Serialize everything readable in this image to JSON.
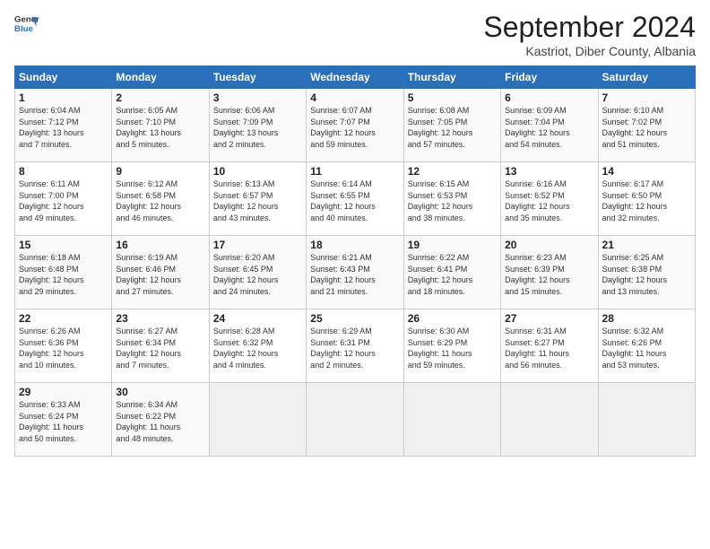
{
  "header": {
    "logo_line1": "General",
    "logo_line2": "Blue",
    "month": "September 2024",
    "location": "Kastriot, Diber County, Albania"
  },
  "weekdays": [
    "Sunday",
    "Monday",
    "Tuesday",
    "Wednesday",
    "Thursday",
    "Friday",
    "Saturday"
  ],
  "weeks": [
    [
      {
        "day": "1",
        "info": "Sunrise: 6:04 AM\nSunset: 7:12 PM\nDaylight: 13 hours\nand 7 minutes."
      },
      {
        "day": "2",
        "info": "Sunrise: 6:05 AM\nSunset: 7:10 PM\nDaylight: 13 hours\nand 5 minutes."
      },
      {
        "day": "3",
        "info": "Sunrise: 6:06 AM\nSunset: 7:09 PM\nDaylight: 13 hours\nand 2 minutes."
      },
      {
        "day": "4",
        "info": "Sunrise: 6:07 AM\nSunset: 7:07 PM\nDaylight: 12 hours\nand 59 minutes."
      },
      {
        "day": "5",
        "info": "Sunrise: 6:08 AM\nSunset: 7:05 PM\nDaylight: 12 hours\nand 57 minutes."
      },
      {
        "day": "6",
        "info": "Sunrise: 6:09 AM\nSunset: 7:04 PM\nDaylight: 12 hours\nand 54 minutes."
      },
      {
        "day": "7",
        "info": "Sunrise: 6:10 AM\nSunset: 7:02 PM\nDaylight: 12 hours\nand 51 minutes."
      }
    ],
    [
      {
        "day": "8",
        "info": "Sunrise: 6:11 AM\nSunset: 7:00 PM\nDaylight: 12 hours\nand 49 minutes."
      },
      {
        "day": "9",
        "info": "Sunrise: 6:12 AM\nSunset: 6:58 PM\nDaylight: 12 hours\nand 46 minutes."
      },
      {
        "day": "10",
        "info": "Sunrise: 6:13 AM\nSunset: 6:57 PM\nDaylight: 12 hours\nand 43 minutes."
      },
      {
        "day": "11",
        "info": "Sunrise: 6:14 AM\nSunset: 6:55 PM\nDaylight: 12 hours\nand 40 minutes."
      },
      {
        "day": "12",
        "info": "Sunrise: 6:15 AM\nSunset: 6:53 PM\nDaylight: 12 hours\nand 38 minutes."
      },
      {
        "day": "13",
        "info": "Sunrise: 6:16 AM\nSunset: 6:52 PM\nDaylight: 12 hours\nand 35 minutes."
      },
      {
        "day": "14",
        "info": "Sunrise: 6:17 AM\nSunset: 6:50 PM\nDaylight: 12 hours\nand 32 minutes."
      }
    ],
    [
      {
        "day": "15",
        "info": "Sunrise: 6:18 AM\nSunset: 6:48 PM\nDaylight: 12 hours\nand 29 minutes."
      },
      {
        "day": "16",
        "info": "Sunrise: 6:19 AM\nSunset: 6:46 PM\nDaylight: 12 hours\nand 27 minutes."
      },
      {
        "day": "17",
        "info": "Sunrise: 6:20 AM\nSunset: 6:45 PM\nDaylight: 12 hours\nand 24 minutes."
      },
      {
        "day": "18",
        "info": "Sunrise: 6:21 AM\nSunset: 6:43 PM\nDaylight: 12 hours\nand 21 minutes."
      },
      {
        "day": "19",
        "info": "Sunrise: 6:22 AM\nSunset: 6:41 PM\nDaylight: 12 hours\nand 18 minutes."
      },
      {
        "day": "20",
        "info": "Sunrise: 6:23 AM\nSunset: 6:39 PM\nDaylight: 12 hours\nand 15 minutes."
      },
      {
        "day": "21",
        "info": "Sunrise: 6:25 AM\nSunset: 6:38 PM\nDaylight: 12 hours\nand 13 minutes."
      }
    ],
    [
      {
        "day": "22",
        "info": "Sunrise: 6:26 AM\nSunset: 6:36 PM\nDaylight: 12 hours\nand 10 minutes."
      },
      {
        "day": "23",
        "info": "Sunrise: 6:27 AM\nSunset: 6:34 PM\nDaylight: 12 hours\nand 7 minutes."
      },
      {
        "day": "24",
        "info": "Sunrise: 6:28 AM\nSunset: 6:32 PM\nDaylight: 12 hours\nand 4 minutes."
      },
      {
        "day": "25",
        "info": "Sunrise: 6:29 AM\nSunset: 6:31 PM\nDaylight: 12 hours\nand 2 minutes."
      },
      {
        "day": "26",
        "info": "Sunrise: 6:30 AM\nSunset: 6:29 PM\nDaylight: 11 hours\nand 59 minutes."
      },
      {
        "day": "27",
        "info": "Sunrise: 6:31 AM\nSunset: 6:27 PM\nDaylight: 11 hours\nand 56 minutes."
      },
      {
        "day": "28",
        "info": "Sunrise: 6:32 AM\nSunset: 6:26 PM\nDaylight: 11 hours\nand 53 minutes."
      }
    ],
    [
      {
        "day": "29",
        "info": "Sunrise: 6:33 AM\nSunset: 6:24 PM\nDaylight: 11 hours\nand 50 minutes."
      },
      {
        "day": "30",
        "info": "Sunrise: 6:34 AM\nSunset: 6:22 PM\nDaylight: 11 hours\nand 48 minutes."
      },
      {
        "day": "",
        "info": ""
      },
      {
        "day": "",
        "info": ""
      },
      {
        "day": "",
        "info": ""
      },
      {
        "day": "",
        "info": ""
      },
      {
        "day": "",
        "info": ""
      }
    ]
  ]
}
